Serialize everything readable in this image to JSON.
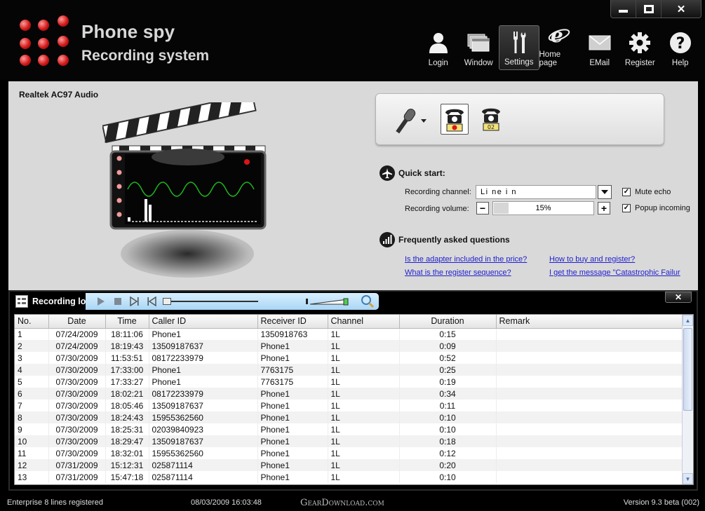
{
  "app": {
    "title_line1": "Phone spy",
    "title_line2": "Recording system"
  },
  "window_controls": {
    "minimize": "minimize",
    "maximize": "maximize",
    "close": "✕"
  },
  "toolbar": {
    "items": [
      {
        "label": "Login",
        "icon": "user-icon",
        "active": false
      },
      {
        "label": "Window",
        "icon": "window-icon",
        "active": false
      },
      {
        "label": "Settings",
        "icon": "settings-icon",
        "active": true
      },
      {
        "label": "Home page",
        "icon": "ie-icon",
        "active": false
      },
      {
        "label": "EMail",
        "icon": "email-icon",
        "active": false
      },
      {
        "label": "Register",
        "icon": "gear-icon",
        "active": false
      },
      {
        "label": "Help",
        "icon": "help-icon",
        "active": false
      }
    ]
  },
  "device": {
    "name": "Realtek AC97 Audio"
  },
  "channels": {
    "phone2_label": "02"
  },
  "quick_start": {
    "title": "Quick start:",
    "recording_channel_label": "Recording channel:",
    "recording_channel_value": "Li ne i n",
    "recording_volume_label": "Recording volume:",
    "recording_volume_value": "15%",
    "recording_volume_fraction": 0.15,
    "minus": "−",
    "plus": "+",
    "mute_echo_label": "Mute echo",
    "mute_echo_checked": true,
    "popup_incoming_label": "Popup incoming",
    "popup_incoming_checked": true,
    "check_mark": "✓"
  },
  "faq": {
    "title": "Frequently asked questions",
    "links": [
      "Is the adapter included in the price?",
      "How to buy and register?",
      "What is the register sequence?",
      "I get the message \"Catastrophic Failur"
    ]
  },
  "log": {
    "title": "Recording log",
    "close": "✕",
    "columns": [
      "No.",
      "Date",
      "Time",
      "Caller ID",
      "Receiver ID",
      "Channel",
      "Duration",
      "Remark"
    ],
    "rows": [
      [
        "1",
        "07/24/2009",
        "18:11:06",
        "Phone1",
        "1350918763",
        "1L",
        "0:15",
        ""
      ],
      [
        "2",
        "07/24/2009",
        "18:19:43",
        "13509187637",
        "Phone1",
        "1L",
        "0:09",
        ""
      ],
      [
        "3",
        "07/30/2009",
        "11:53:51",
        "08172233979",
        "Phone1",
        "1L",
        "0:52",
        ""
      ],
      [
        "4",
        "07/30/2009",
        "17:33:00",
        "Phone1",
        "7763175",
        "1L",
        "0:25",
        ""
      ],
      [
        "5",
        "07/30/2009",
        "17:33:27",
        "Phone1",
        "7763175",
        "1L",
        "0:19",
        ""
      ],
      [
        "6",
        "07/30/2009",
        "18:02:21",
        "08172233979",
        "Phone1",
        "1L",
        "0:34",
        ""
      ],
      [
        "7",
        "07/30/2009",
        "18:05:46",
        "13509187637",
        "Phone1",
        "1L",
        "0:11",
        ""
      ],
      [
        "8",
        "07/30/2009",
        "18:24:43",
        "15955362560",
        "Phone1",
        "1L",
        "0:10",
        ""
      ],
      [
        "9",
        "07/30/2009",
        "18:25:31",
        "02039840923",
        "Phone1",
        "1L",
        "0:10",
        ""
      ],
      [
        "10",
        "07/30/2009",
        "18:29:47",
        "13509187637",
        "Phone1",
        "1L",
        "0:18",
        ""
      ],
      [
        "11",
        "07/30/2009",
        "18:32:01",
        "15955362560",
        "Phone1",
        "1L",
        "0:12",
        ""
      ],
      [
        "12",
        "07/31/2009",
        "15:12:31",
        "025871114",
        "Phone1",
        "1L",
        "0:20",
        ""
      ],
      [
        "13",
        "07/31/2009",
        "15:47:18",
        "025871114",
        "Phone1",
        "1L",
        "0:10",
        ""
      ]
    ]
  },
  "status_bar": {
    "license": "Enterprise 8 lines registered",
    "datetime": "08/03/2009  16:03:48",
    "watermark": "GearDownload.com",
    "version": "Version 9.3 beta (002)"
  },
  "colors": {
    "accent_red": "#d11a1a",
    "panel_gray": "#d9d9d9",
    "link_blue": "#1f1fd0",
    "player_blue": "#a9d6f5"
  }
}
